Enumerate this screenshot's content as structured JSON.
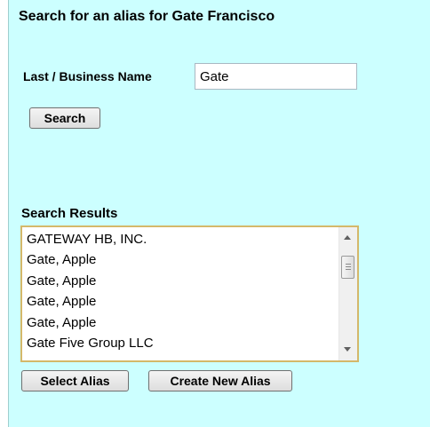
{
  "header": {
    "title": "Search for an alias for Gate Francisco"
  },
  "search": {
    "name_label": "Last / Business Name",
    "name_value": "Gate",
    "search_button_label": "Search"
  },
  "results": {
    "label": "Search Results",
    "items": [
      "GATEWAY HB, INC.",
      "Gate, Apple",
      "Gate, Apple",
      "Gate, Apple",
      "Gate, Apple",
      "Gate Five Group LLC"
    ]
  },
  "actions": {
    "select_alias_label": "Select Alias",
    "create_alias_label": "Create New Alias"
  },
  "colors": {
    "panel_background": "#ccffff",
    "list_border": "#d4b86a"
  }
}
